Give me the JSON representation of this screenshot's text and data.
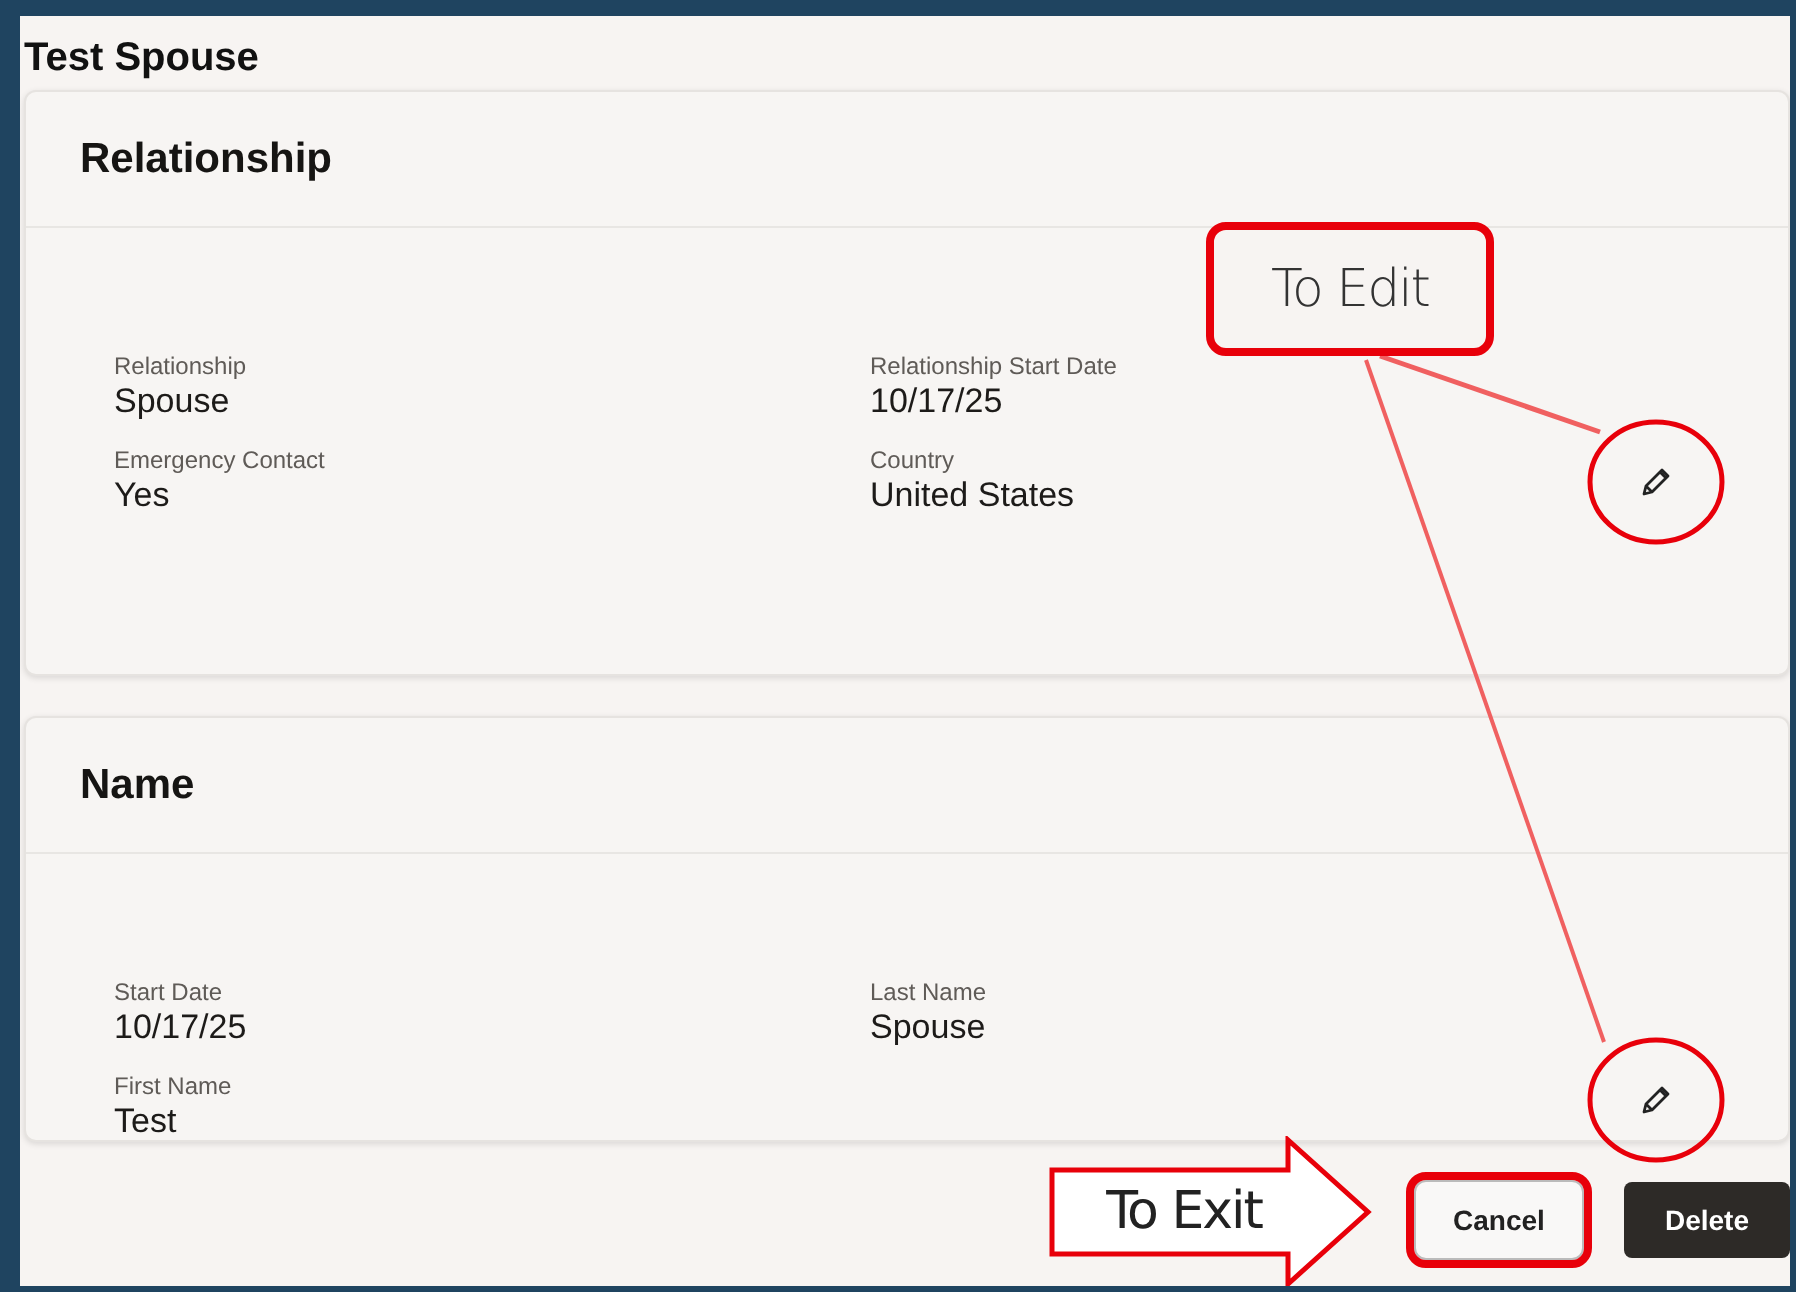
{
  "title": "Test Spouse",
  "sections": [
    {
      "title": "Relationship",
      "fields": [
        {
          "label": "Relationship",
          "value": "Spouse"
        },
        {
          "label": "Relationship Start Date",
          "value": "10/17/25"
        },
        {
          "label": "Emergency Contact",
          "value": "Yes"
        },
        {
          "label": "Country",
          "value": "United States"
        }
      ]
    },
    {
      "title": "Name",
      "fields": [
        {
          "label": "Start Date",
          "value": "10/17/25"
        },
        {
          "label": "Last Name",
          "value": "Spouse"
        },
        {
          "label": "First Name",
          "value": "Test"
        }
      ]
    }
  ],
  "annotations": [
    {
      "kind": "callout",
      "text": "To Edit"
    },
    {
      "kind": "arrow",
      "text": "To Exit"
    }
  ],
  "buttons": [
    {
      "label": "Cancel",
      "kind": "secondary",
      "highlighted": true
    },
    {
      "label": "Delete",
      "kind": "primary",
      "highlighted": false
    }
  ]
}
